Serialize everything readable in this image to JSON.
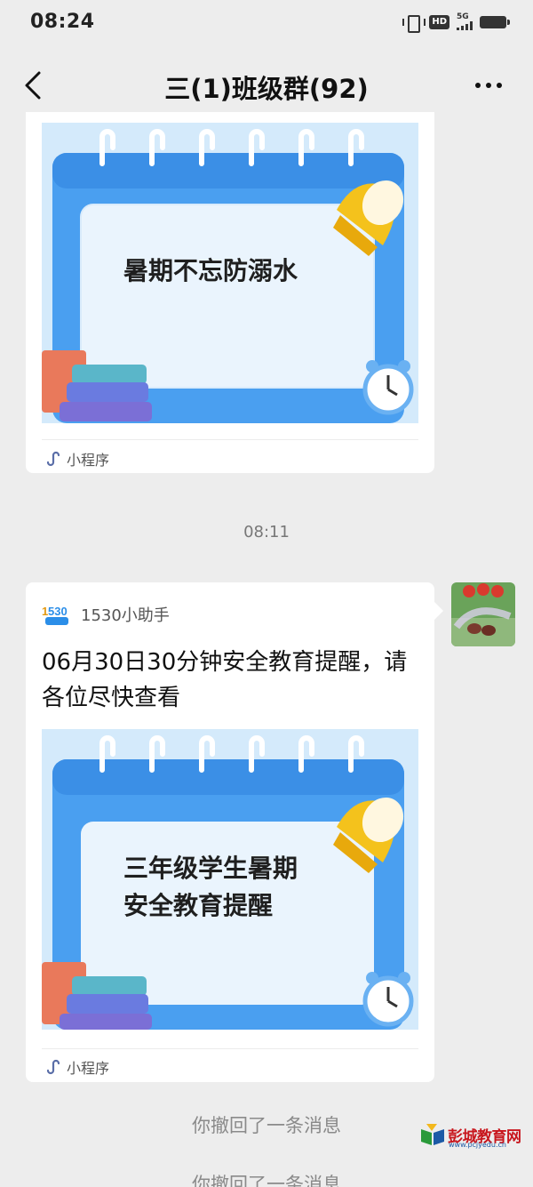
{
  "status_bar": {
    "time": "08:24",
    "network": "5G",
    "hd_label": "HD"
  },
  "nav": {
    "title": "三(1)班级群(92)"
  },
  "messages": [
    {
      "cover_lines": [
        "暑期不忘防溺水"
      ],
      "tag": "小程序"
    },
    {
      "sender": "1530小助手",
      "logo_text": "1530",
      "logo_sub": "小助手",
      "title": "06月30日30分钟安全教育提醒，请各位尽快查看",
      "cover_lines": [
        "三年级学生暑期",
        "安全教育提醒"
      ],
      "tag": "小程序"
    }
  ],
  "timestamp": "08:11",
  "system_notices": [
    "你撤回了一条消息",
    "你撤回了一条消息"
  ],
  "watermark": {
    "name": "彭城教育网",
    "url": "www.pcjyedu.cn"
  },
  "colors": {
    "background": "#ededed",
    "card": "#ffffff",
    "calendar_blue": "#4a9ff0",
    "watermark_red": "#c8161d"
  },
  "icons": [
    "back-arrow-icon",
    "more-icon",
    "mini-program-icon",
    "bell-icon",
    "clock-icon",
    "books-icon"
  ]
}
